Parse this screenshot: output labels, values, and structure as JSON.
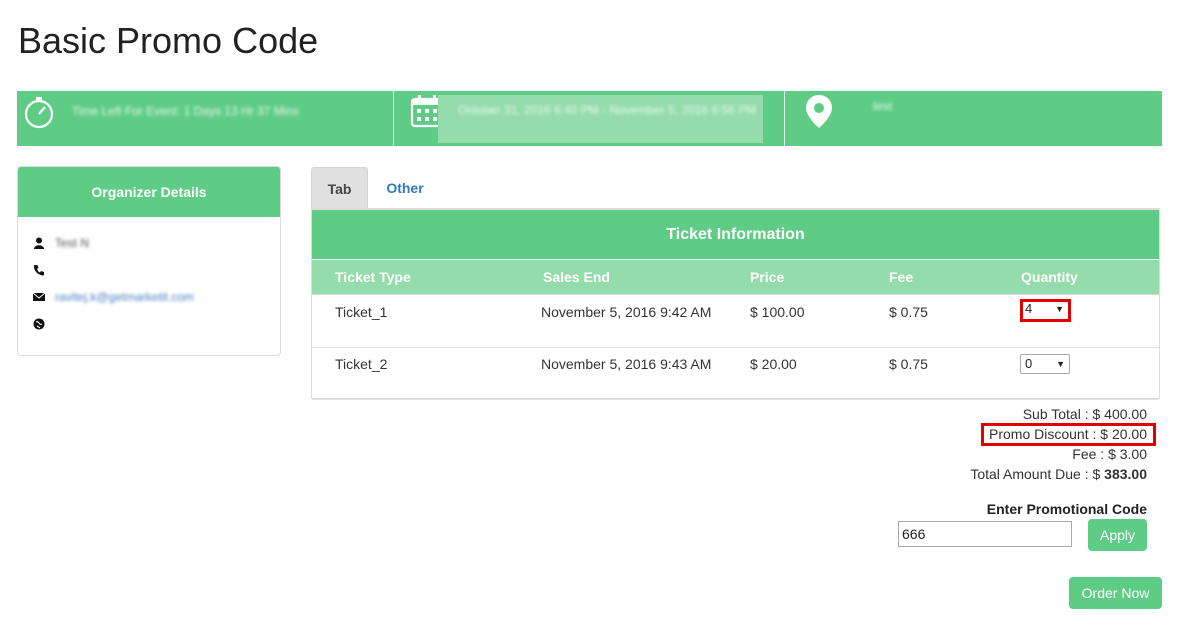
{
  "page": {
    "title": "Basic Promo Code"
  },
  "info_bar": {
    "time_left": "Time Left For Event: 1 Days 13 Hr 37 Mins",
    "dates": "October 31, 2016 6:40 PM - November 5, 2016 6:56 PM",
    "location": "test"
  },
  "organizer": {
    "header": "Organizer Details",
    "name": "Test N",
    "email": "ravitej.k@getmarketit.com"
  },
  "tabs": [
    {
      "label": "Tab"
    },
    {
      "label": "Other"
    }
  ],
  "tickets": {
    "header": "Ticket Information",
    "columns": [
      "Ticket Type",
      "Sales End",
      "Price",
      "Fee",
      "Quantity"
    ],
    "rows": [
      {
        "type": "Ticket_1",
        "sales_end": "November 5, 2016 9:42 AM",
        "price": "$ 100.00",
        "fee": "$ 0.75",
        "quantity": "4"
      },
      {
        "type": "Ticket_2",
        "sales_end": "November 5, 2016 9:43 AM",
        "price": "$ 20.00",
        "fee": "$ 0.75",
        "quantity": "0"
      }
    ]
  },
  "summary": {
    "subtotal_label": "Sub Total : $ 400.00",
    "promo_label": "Promo Discount : $ 20.00",
    "fee_label": "Fee : $ 3.00",
    "total_prefix": "Total Amount Due : $",
    "total_value": "383.00"
  },
  "promo": {
    "label": "Enter Promotional Code",
    "value": "666",
    "apply_label": "Apply"
  },
  "order_label": "Order Now",
  "colors": {
    "accent": "#5fcc85",
    "accent_light": "#94dcab",
    "highlight": "#e00000",
    "link": "#337ab7"
  },
  "icons": [
    "stopwatch-icon",
    "calendar-icon",
    "map-pin-icon",
    "user-icon",
    "phone-icon",
    "envelope-icon",
    "globe-icon",
    "caret-down-icon"
  ]
}
